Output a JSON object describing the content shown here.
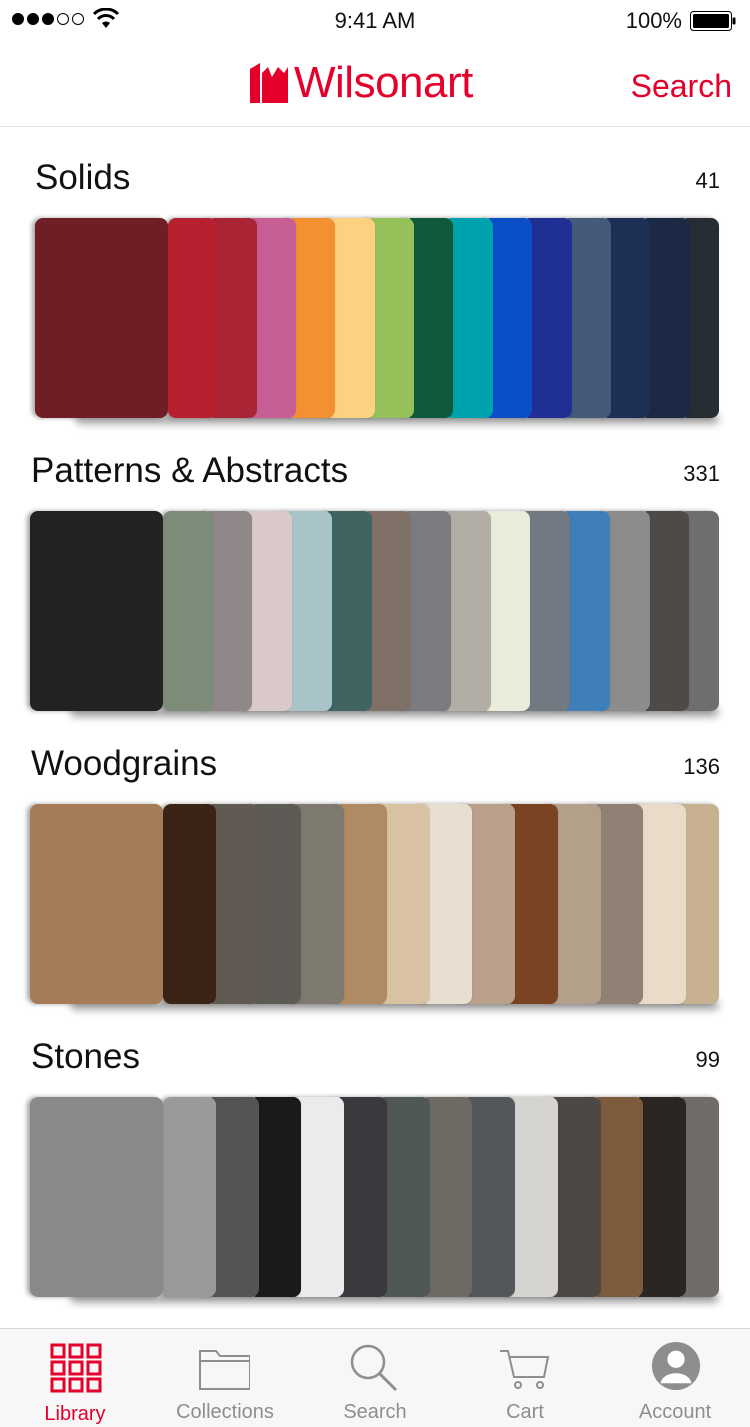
{
  "status_bar": {
    "time": "9:41 AM",
    "battery": "100%"
  },
  "header": {
    "brand": "Wilsonart",
    "search_label": "Search",
    "accent": "#e4002b"
  },
  "sections": [
    {
      "title": "Solids",
      "count": "41",
      "swatches": [
        "#701e25",
        "#b8202f",
        "#a92434",
        "#c66094",
        "#f39031",
        "#fbd281",
        "#96c05a",
        "#0f5a3b",
        "#00a3ad",
        "#0a4fc8",
        "#1f2f94",
        "#445a78",
        "#1d2f55",
        "#1c2944",
        "#262d33"
      ]
    },
    {
      "title": "Patterns & Abstracts",
      "count": "331",
      "swatches": [
        "#232223",
        "#7d8c78",
        "#8f8788",
        "#d9c9cb",
        "#a9c4c8",
        "#3f6461",
        "#7f7068",
        "#7a7c80",
        "#b2aea6",
        "#eaeddc",
        "#717a82",
        "#3e7fba",
        "#8c8c8c",
        "#4d4a48",
        "#6e6e70"
      ]
    },
    {
      "title": "Woodgrains",
      "count": "136",
      "swatches": [
        "#a57b58",
        "#3a2416",
        "#605a52",
        "#5e5a55",
        "#7e7a70",
        "#b08a63",
        "#d8c2a3",
        "#e8dfd2",
        "#b9a08a",
        "#7a4321",
        "#b3a08b",
        "#8f8174",
        "#e8dcc8",
        "#c8b191"
      ]
    },
    {
      "title": "Stones",
      "count": "99",
      "swatches": [
        "#8a8987",
        "#9a9a9c",
        "#565452",
        "#1a1a1a",
        "#ebebeb",
        "#3b393d",
        "#4f5855",
        "#6d6a63",
        "#53575b",
        "#d6d4d0",
        "#4e4845",
        "#7d5c3e",
        "#2b2622",
        "#6f6c6a"
      ]
    }
  ],
  "tabs": [
    {
      "label": "Library",
      "icon": "grid-icon",
      "active": true
    },
    {
      "label": "Collections",
      "icon": "folder-icon",
      "active": false
    },
    {
      "label": "Search",
      "icon": "search-icon",
      "active": false
    },
    {
      "label": "Cart",
      "icon": "cart-icon",
      "active": false
    },
    {
      "label": "Account",
      "icon": "person-icon",
      "active": false
    }
  ],
  "colors": {
    "tab_inactive": "#8e8e8e",
    "tab_active": "#e4002b"
  }
}
